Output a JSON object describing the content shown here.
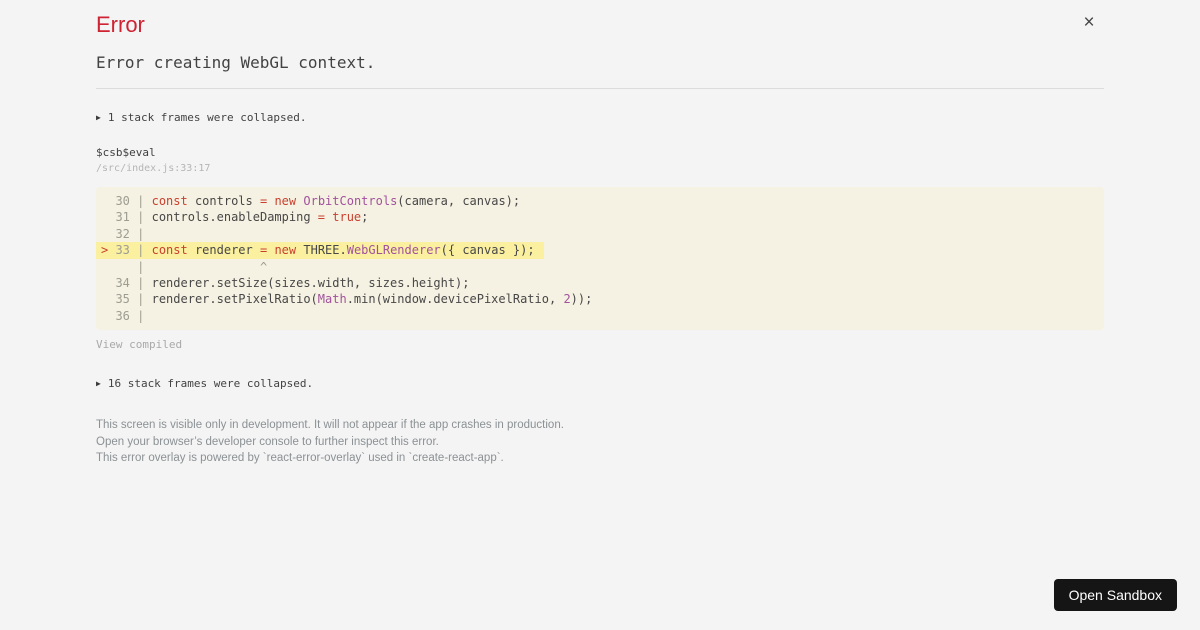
{
  "colors": {
    "bg": "#f4f4f4",
    "title_red": "#ce2333",
    "divider": "#dcdcdc",
    "code_bg": "#f6f2e3",
    "highlight_bg": "#fbf0a0",
    "code_plain": "#474747",
    "keyword": "#c8402f",
    "class_purple": "#a0529c",
    "gutter": "#9c9c90",
    "loc_gray": "#b5b5b5",
    "view_gray": "#a9a9a9",
    "footer_gray": "#8b9194",
    "button_bg": "#151515",
    "button_text": "#ffffff"
  },
  "overlay": {
    "title": "Error",
    "close_glyph": "×",
    "message": "Error creating WebGL context.",
    "collapse_icon": "▶",
    "collapsed_top_label": "1 stack frames were collapsed.",
    "stack_frame": {
      "function_name": "$csb$eval",
      "source_location": "/src/index.js:33:17"
    },
    "view_compiled_label": "View compiled",
    "collapsed_bottom_label": "16 stack frames were collapsed.",
    "footer_lines": [
      "This screen is visible only in development. It will not appear if the app crashes in production.",
      "Open your browser’s developer console to further inspect this error.",
      "This error overlay is powered by `react-error-overlay` used in `create-react-app`."
    ]
  },
  "code_block": {
    "lines": [
      {
        "num": "30",
        "marker": "",
        "highlight": false,
        "segments": [
          {
            "t": "keyword",
            "s": "const"
          },
          {
            "t": "plain",
            "s": " controls "
          },
          {
            "t": "keyword",
            "s": "="
          },
          {
            "t": "plain",
            "s": " "
          },
          {
            "t": "keyword",
            "s": "new"
          },
          {
            "t": "plain",
            "s": " "
          },
          {
            "t": "class",
            "s": "OrbitControls"
          },
          {
            "t": "plain",
            "s": "(camera, canvas);"
          }
        ]
      },
      {
        "num": "31",
        "marker": "",
        "highlight": false,
        "segments": [
          {
            "t": "plain",
            "s": "controls.enableDamping "
          },
          {
            "t": "keyword",
            "s": "="
          },
          {
            "t": "plain",
            "s": " "
          },
          {
            "t": "keyword",
            "s": "true"
          },
          {
            "t": "plain",
            "s": ";"
          }
        ]
      },
      {
        "num": "32",
        "marker": "",
        "highlight": false,
        "segments": []
      },
      {
        "num": "33",
        "marker": ">",
        "highlight": true,
        "segments": [
          {
            "t": "keyword",
            "s": "const"
          },
          {
            "t": "plain",
            "s": " renderer "
          },
          {
            "t": "keyword",
            "s": "="
          },
          {
            "t": "plain",
            "s": " "
          },
          {
            "t": "keyword",
            "s": "new"
          },
          {
            "t": "plain",
            "s": " THREE."
          },
          {
            "t": "class",
            "s": "WebGLRenderer"
          },
          {
            "t": "plain",
            "s": "({ canvas });"
          }
        ]
      },
      {
        "num": "",
        "marker": "",
        "highlight": false,
        "segments": [
          {
            "t": "caret",
            "s": "               ^"
          }
        ]
      },
      {
        "num": "34",
        "marker": "",
        "highlight": false,
        "segments": [
          {
            "t": "plain",
            "s": "renderer.setSize(sizes.width, sizes.height);"
          }
        ]
      },
      {
        "num": "35",
        "marker": "",
        "highlight": false,
        "segments": [
          {
            "t": "plain",
            "s": "renderer.setPixelRatio("
          },
          {
            "t": "class",
            "s": "Math"
          },
          {
            "t": "plain",
            "s": ".min(window.devicePixelRatio, "
          },
          {
            "t": "class",
            "s": "2"
          },
          {
            "t": "plain",
            "s": "));"
          }
        ]
      },
      {
        "num": "36",
        "marker": "",
        "highlight": false,
        "segments": []
      }
    ]
  },
  "sandbox_button": {
    "label": "Open Sandbox"
  }
}
